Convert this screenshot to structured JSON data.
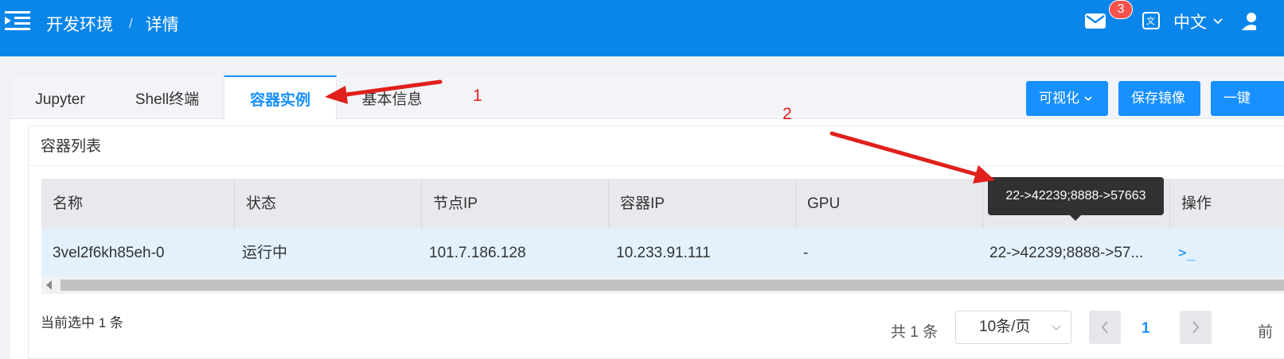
{
  "header": {
    "breadcrumb": [
      "开发环境",
      "详情"
    ],
    "breadcrumb_separator": "/",
    "notification_count": "3",
    "language": "中文",
    "icons": [
      "menu-icon",
      "mail-icon",
      "translate-icon",
      "user-icon"
    ]
  },
  "tabs": [
    {
      "label": "Jupyter"
    },
    {
      "label": "Shell终端"
    },
    {
      "label": "容器实例"
    },
    {
      "label": "基本信息"
    }
  ],
  "active_tab": "容器实例",
  "actions": {
    "visualize": "可视化",
    "save_image": "保存镜像",
    "one_click": "一键"
  },
  "panel": {
    "title": "容器列表"
  },
  "table": {
    "columns": [
      "名称",
      "状态",
      "节点IP",
      "容器IP",
      "GPU",
      "",
      "操作"
    ],
    "rows": [
      {
        "name": "3vel2f6kh85eh-0",
        "status": "运行中",
        "node_ip": "101.7.186.128",
        "container_ip": "10.233.91.111",
        "gpu": "-",
        "ports": "22->42239;8888->57...",
        "action_icon": ">_"
      }
    ]
  },
  "tooltip": "22->42239;8888->57663",
  "footer": {
    "selected": "当前选中 1 条",
    "total": "共 1 条",
    "page_size": "10条/页",
    "current_page": "1",
    "goto_prefix": "前"
  },
  "annotations": {
    "label1": "1",
    "label2": "2",
    "color": "#e0201c"
  },
  "colors": {
    "header": "#0a86ea",
    "primary": "#1890ff",
    "badge": "#f5524b",
    "selected_row": "#e3f1fd",
    "tooltip": "#303133"
  }
}
